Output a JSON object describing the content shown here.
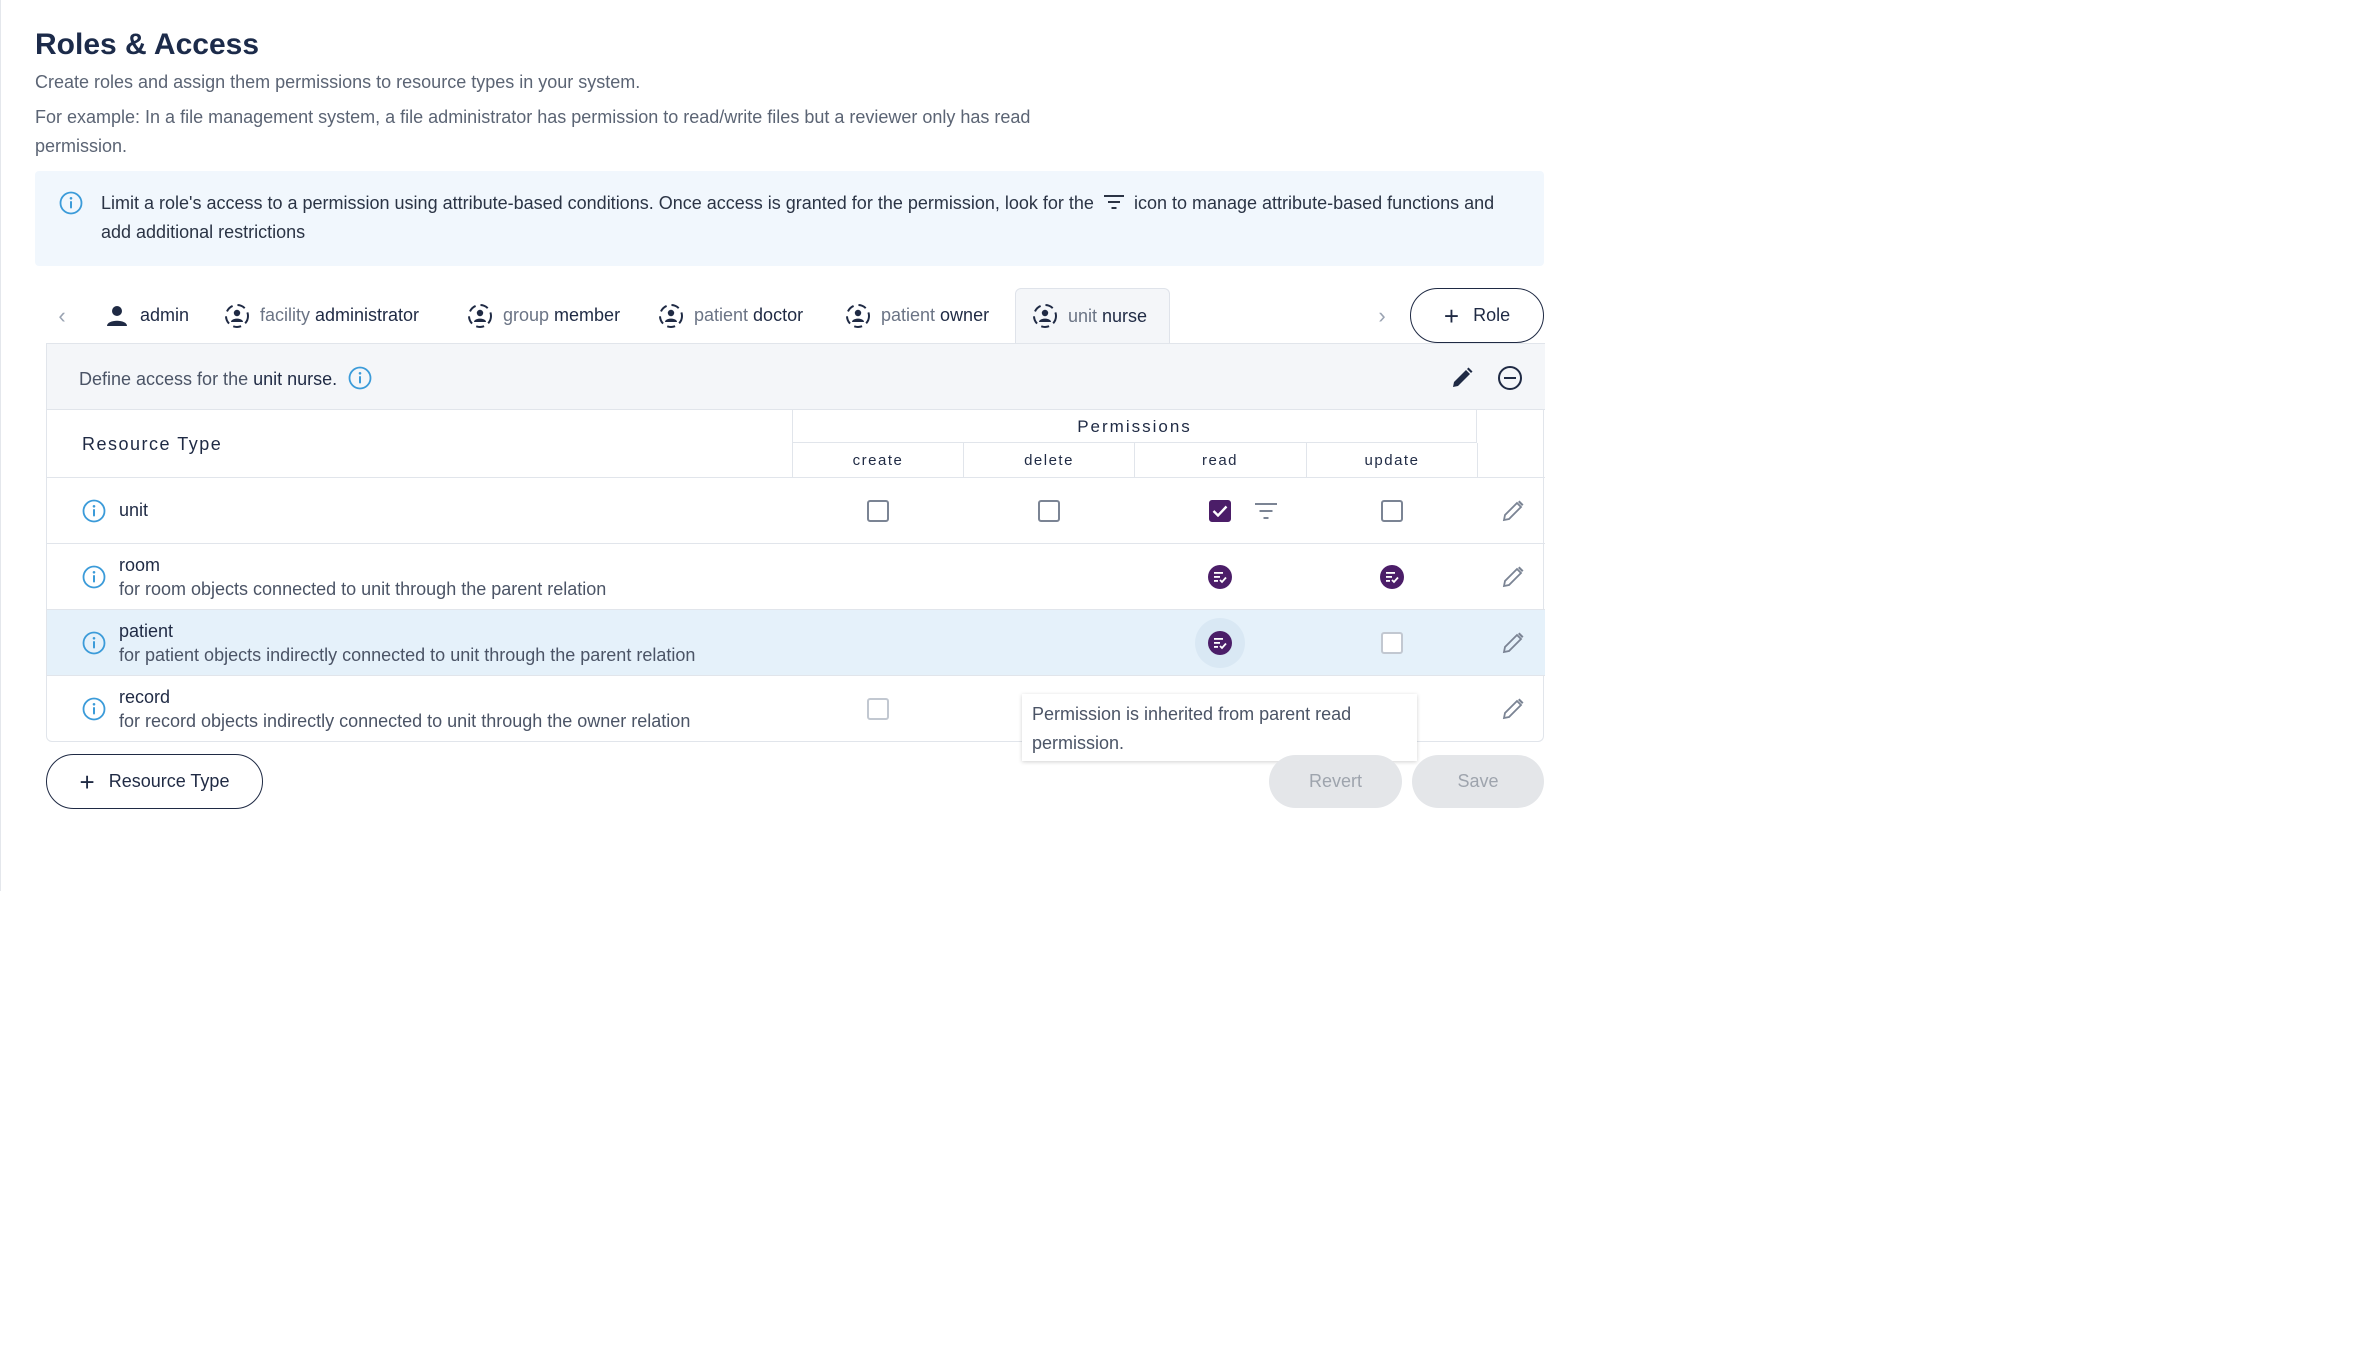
{
  "header": {
    "title": "Roles & Access",
    "description": "Create roles and assign them permissions to resource types in your system.",
    "example": "For example: In a file management system, a file administrator has permission to read/write files but a reviewer only has read permission."
  },
  "banner": {
    "text_before": "Limit a role's access to a permission using attribute-based conditions. Once access is granted for the permission, look for the",
    "text_after": "icon to manage attribute-based functions and add additional restrictions"
  },
  "tabs": [
    {
      "prefix": "",
      "label": "admin",
      "icon": "user-icon",
      "active": false
    },
    {
      "prefix": "facility",
      "label": "administrator",
      "icon": "scoped-user-icon",
      "active": false
    },
    {
      "prefix": "group",
      "label": "member",
      "icon": "scoped-user-icon",
      "active": false
    },
    {
      "prefix": "patient",
      "label": "doctor",
      "icon": "scoped-user-icon",
      "active": false
    },
    {
      "prefix": "patient",
      "label": "owner",
      "icon": "scoped-user-icon",
      "active": false
    },
    {
      "prefix": "unit",
      "label": "nurse",
      "icon": "scoped-user-icon",
      "active": true
    }
  ],
  "role_button": {
    "label": "Role"
  },
  "panel": {
    "define_prefix": "Define access for the",
    "role_name": "unit nurse."
  },
  "table": {
    "resource_header": "Resource Type",
    "permissions_header": "Permissions",
    "columns": [
      "create",
      "delete",
      "read",
      "update"
    ],
    "rows": [
      {
        "name": "unit",
        "sub": "",
        "create": "unchecked",
        "delete": "unchecked",
        "read": "checked",
        "update": "unchecked"
      },
      {
        "name": "room",
        "sub": "for room objects connected to unit through the parent relation",
        "create": "none",
        "delete": "none",
        "read": "inherited",
        "update": "inherited"
      },
      {
        "name": "patient",
        "sub": "for patient objects indirectly connected to unit through the parent relation",
        "create": "none",
        "delete": "none",
        "read": "inherited",
        "update": "unchecked"
      },
      {
        "name": "record",
        "sub": "for record objects indirectly connected to unit through the owner relation",
        "create": "unchecked",
        "delete": "none",
        "read": "none",
        "update": "none"
      }
    ]
  },
  "tooltip": {
    "text": "Permission is inherited from parent read permission."
  },
  "footer": {
    "add_resource_label": "Resource Type",
    "revert_label": "Revert",
    "save_label": "Save"
  },
  "colors": {
    "accent": "#4b1d68",
    "info": "#3b9bd9",
    "banner_bg": "#f1f7fd",
    "highlight_row": "#e5f1fa"
  }
}
